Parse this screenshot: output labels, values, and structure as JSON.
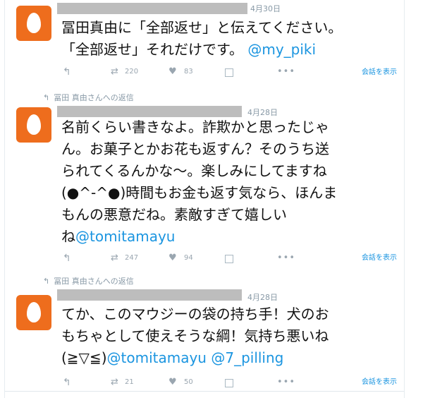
{
  "tweets": [
    {
      "reply_context": "",
      "date": "4月30日",
      "lines": [
        "冨田真由に「全部返せ」と伝えてください。",
        "「全部返せ」それだけです。"
      ],
      "mention_tail": "@my_piki",
      "retweets": "220",
      "likes": "83",
      "view_conversation": "会話を表示"
    },
    {
      "reply_context": "冨田 真由さんへの返信",
      "date": "4月28日",
      "lines": [
        "名前くらい書きなよ。詐欺かと思ったじゃ",
        "ん。お菓子とかお花も返すん？そのうち送",
        "られてくるんかな〜。楽しみにしてますね",
        "(●^-^●)時間もお金も返す気なら、ほんま",
        "もんの悪意だね。素敵すぎて嬉しい"
      ],
      "last_prefix": "ね",
      "mention_tail": "@tomitamayu",
      "retweets": "247",
      "likes": "94",
      "view_conversation": "会話を表示"
    },
    {
      "reply_context": "冨田 真由さんへの返信",
      "date": "4月28日",
      "lines": [
        "てか、このマウジーの袋の持ち手！犬のお",
        "もちゃとして使えそうな綱！気持ち悪いね"
      ],
      "last_prefix": "(≧▽≦)",
      "mention_tail": "@tomitamayu @7_pilling",
      "retweets": "21",
      "likes": "50",
      "view_conversation": "会話を表示"
    }
  ],
  "icons": {
    "reply": "reply-icon",
    "retweet": "retweet-icon",
    "like": "heart-icon",
    "dm": "message-icon",
    "more": "more-icon"
  },
  "colors": {
    "avatar": "#ee6d1d",
    "mention": "#1b95e0",
    "meta": "#8899a6"
  }
}
